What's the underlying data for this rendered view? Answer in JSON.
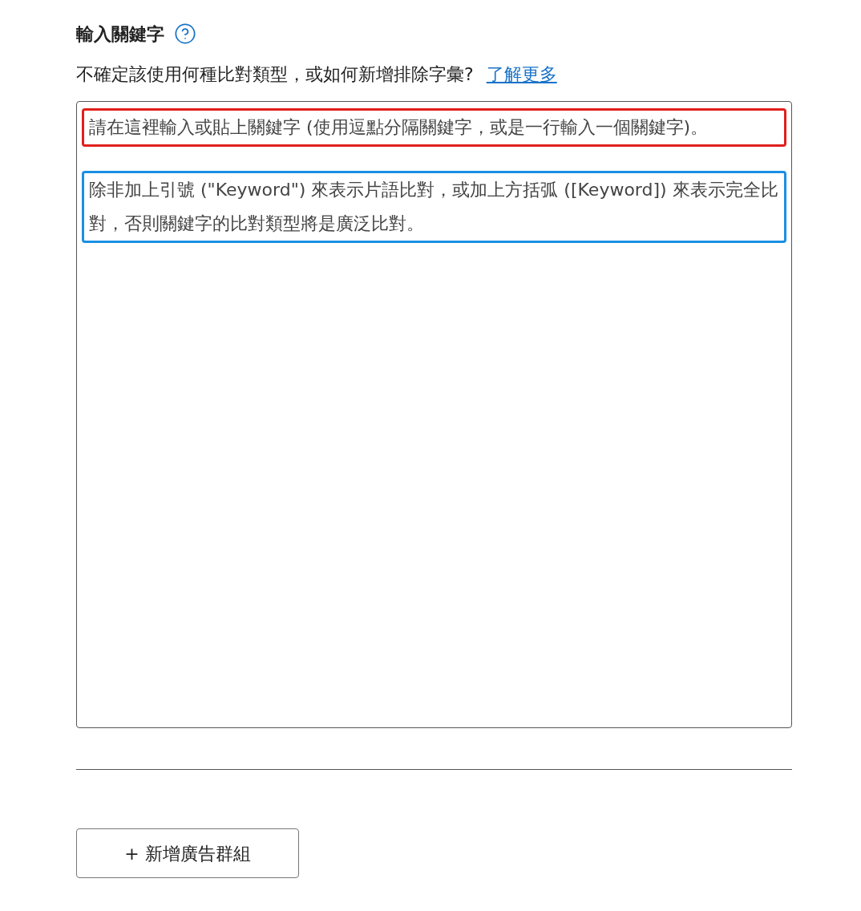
{
  "title": "輸入關鍵字",
  "hint": {
    "text": "不確定該使用何種比對類型，或如何新增排除字彙?",
    "link": "了解更多"
  },
  "keyword_field": {
    "placeholder": [
      {
        "text": "請在這裡輸入或貼上關鍵字 (使用逗點分隔關鍵字，或是一行輸入一個關鍵字)。",
        "color": "#e0201c"
      },
      {
        "text": "除非加上引號 (\"Keyword\") 來表示片語比對，或加上方括弧 ([Keyword]) 來表示完全比對，否則關鍵字的比對類型將是廣泛比對。",
        "color": "#1a8fe3"
      }
    ]
  },
  "add_button": "+ 新增廣告群組"
}
